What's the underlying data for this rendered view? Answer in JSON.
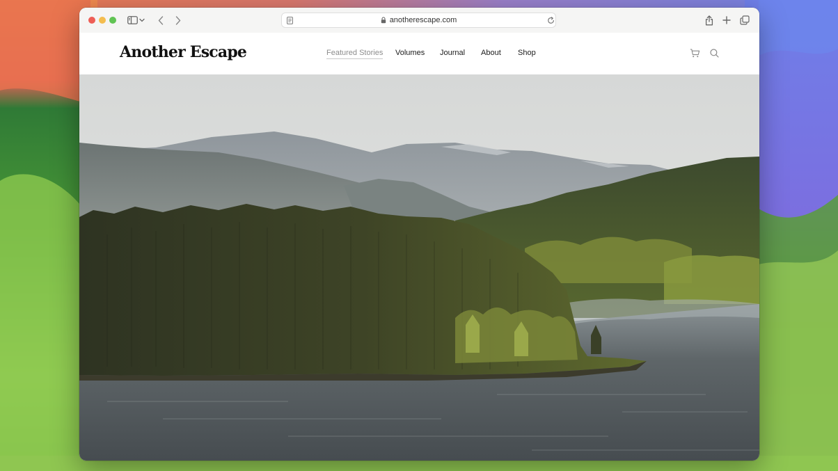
{
  "browser": {
    "url": "anotherescape.com"
  },
  "site": {
    "logo": "Another Escape",
    "nav": [
      {
        "label": "Featured Stories",
        "active": true
      },
      {
        "label": "Volumes"
      },
      {
        "label": "Journal"
      },
      {
        "label": "About"
      },
      {
        "label": "Shop"
      }
    ],
    "icons": [
      "cart-icon",
      "search-icon"
    ]
  },
  "hero": {
    "image": "landscape: forested island on a loch with mountains behind"
  },
  "colors": {
    "traffic_red": "#ee5e56",
    "traffic_yellow": "#f4bd4f",
    "traffic_green": "#61c454",
    "nav_active": "#8c8c8c",
    "nav_text": "#1a1a1a"
  }
}
